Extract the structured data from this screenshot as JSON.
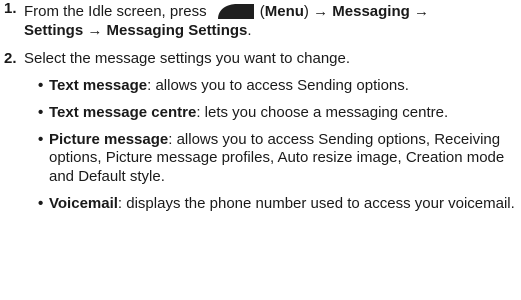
{
  "steps": [
    {
      "number": "1.",
      "text_before_key": "From the Idle screen, press",
      "key_icon": "menu-soft-key-icon",
      "key_label": "Menu",
      "open_paren": "(",
      "close_paren_arrow": ") → ",
      "path_1": "Messaging",
      "arrow_1": " →",
      "path_2": "Settings",
      "arrow_2": " → ",
      "path_3": "Messaging Settings",
      "end": "."
    },
    {
      "number": "2.",
      "text": "Select the message settings you want to change."
    }
  ],
  "bullets": [
    {
      "term": "Text message",
      "desc": ": allows you to access Sending options."
    },
    {
      "term": "Text message centre",
      "desc": ": lets you choose a messaging centre."
    },
    {
      "term": "Picture message",
      "desc": ": allows you to access Sending options, Receiving options, Picture message profiles, Auto resize image, Creation mode and Default style."
    },
    {
      "term": "Voicemail",
      "desc": ": displays the phone number used to access your voicemail."
    }
  ]
}
